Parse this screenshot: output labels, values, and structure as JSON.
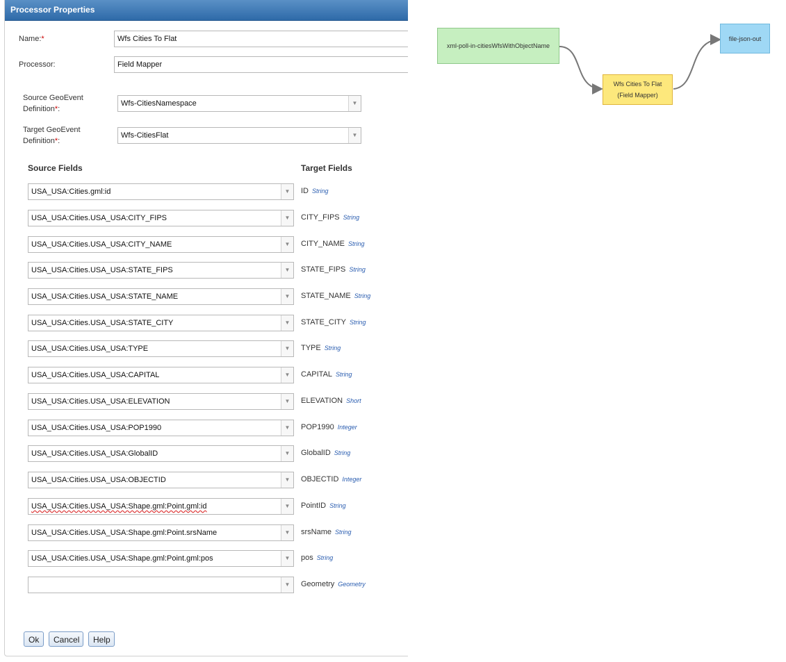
{
  "dialog": {
    "title": "Processor Properties",
    "name_label": "Name:",
    "name_value": "Wfs Cities To Flat",
    "processor_label": "Processor:",
    "processor_value": "Field Mapper",
    "source_def_label_line1": "Source GeoEvent",
    "source_def_label_line2": "Definition",
    "source_def_value": "Wfs-CitiesNamespace",
    "target_def_label_line1": "Target GeoEvent",
    "target_def_label_line2": "Definition",
    "target_def_value": "Wfs-CitiesFlat",
    "required_mark": "*",
    "colon": ":",
    "source_fields_header": "Source Fields",
    "target_fields_header": "Target Fields",
    "mappings": [
      {
        "source": "USA_USA:Cities.gml:id",
        "target": "ID",
        "type": "String"
      },
      {
        "source": "USA_USA:Cities.USA_USA:CITY_FIPS",
        "target": "CITY_FIPS",
        "type": "String"
      },
      {
        "source": "USA_USA:Cities.USA_USA:CITY_NAME",
        "target": "CITY_NAME",
        "type": "String"
      },
      {
        "source": "USA_USA:Cities.USA_USA:STATE_FIPS",
        "target": "STATE_FIPS",
        "type": "String"
      },
      {
        "source": "USA_USA:Cities.USA_USA:STATE_NAME",
        "target": "STATE_NAME",
        "type": "String"
      },
      {
        "source": "USA_USA:Cities.USA_USA:STATE_CITY",
        "target": "STATE_CITY",
        "type": "String"
      },
      {
        "source": "USA_USA:Cities.USA_USA:TYPE",
        "target": "TYPE",
        "type": "String"
      },
      {
        "source": "USA_USA:Cities.USA_USA:CAPITAL",
        "target": "CAPITAL",
        "type": "String"
      },
      {
        "source": "USA_USA:Cities.USA_USA:ELEVATION",
        "target": "ELEVATION",
        "type": "Short"
      },
      {
        "source": "USA_USA:Cities.USA_USA:POP1990",
        "target": "POP1990",
        "type": "Integer"
      },
      {
        "source": "USA_USA:Cities.USA_USA:GlobalID",
        "target": "GlobalID",
        "type": "String"
      },
      {
        "source": "USA_USA:Cities.USA_USA:OBJECTID",
        "target": "OBJECTID",
        "type": "Integer"
      },
      {
        "source": "USA_USA:Cities.USA_USA:Shape.gml:Point.gml:id",
        "target": "PointID",
        "type": "String"
      },
      {
        "source": "USA_USA:Cities.USA_USA:Shape.gml:Point.srsName",
        "target": "srsName",
        "type": "String"
      },
      {
        "source": "USA_USA:Cities.USA_USA:Shape.gml:Point.gml:pos",
        "target": "pos",
        "type": "String"
      },
      {
        "source": "",
        "target": "Geometry",
        "type": "Geometry"
      }
    ],
    "buttons": {
      "ok": "Ok",
      "cancel": "Cancel",
      "help": "Help"
    }
  },
  "flow": {
    "input_node": "xml-poll-in-citiesWfsWithObjectName",
    "processor_node_line1": "Wfs Cities To Flat",
    "processor_node_line2": "(Field Mapper)",
    "output_node": "file-json-out",
    "colors": {
      "input": "#c6efc0",
      "processor": "#fde87c",
      "output": "#9fd8f5"
    }
  }
}
